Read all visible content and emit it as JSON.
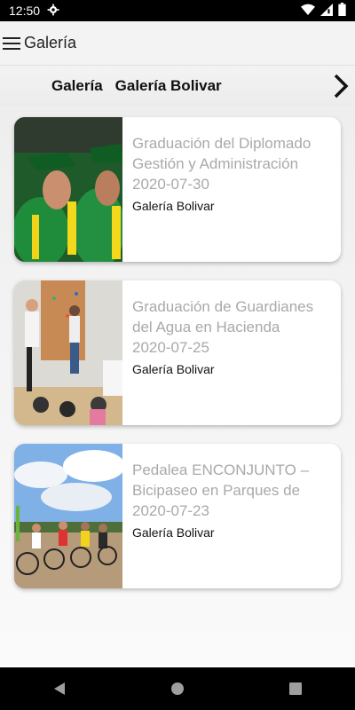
{
  "status_bar": {
    "time": "12:50",
    "icons": [
      "settings-icon",
      "wifi-icon",
      "signal-icon",
      "battery-icon"
    ]
  },
  "app_bar": {
    "title": "Galería"
  },
  "breadcrumb": {
    "items": [
      "Galería",
      "Galería Bolivar"
    ]
  },
  "cards": [
    {
      "title": "Graduación del Diplomado Gestión y Administración",
      "date": "2020-07-30",
      "category": "Galería Bolivar"
    },
    {
      "title": "Graduación de Guardianes del Agua en Hacienda",
      "date": "2020-07-25",
      "category": "Galería Bolivar"
    },
    {
      "title": "Pedalea ENCONJUNTO – Bicipaseo en Parques de",
      "date": "2020-07-23",
      "category": "Galería Bolivar"
    }
  ],
  "nav": {
    "buttons": [
      "back-icon",
      "home-icon",
      "recents-icon"
    ]
  }
}
